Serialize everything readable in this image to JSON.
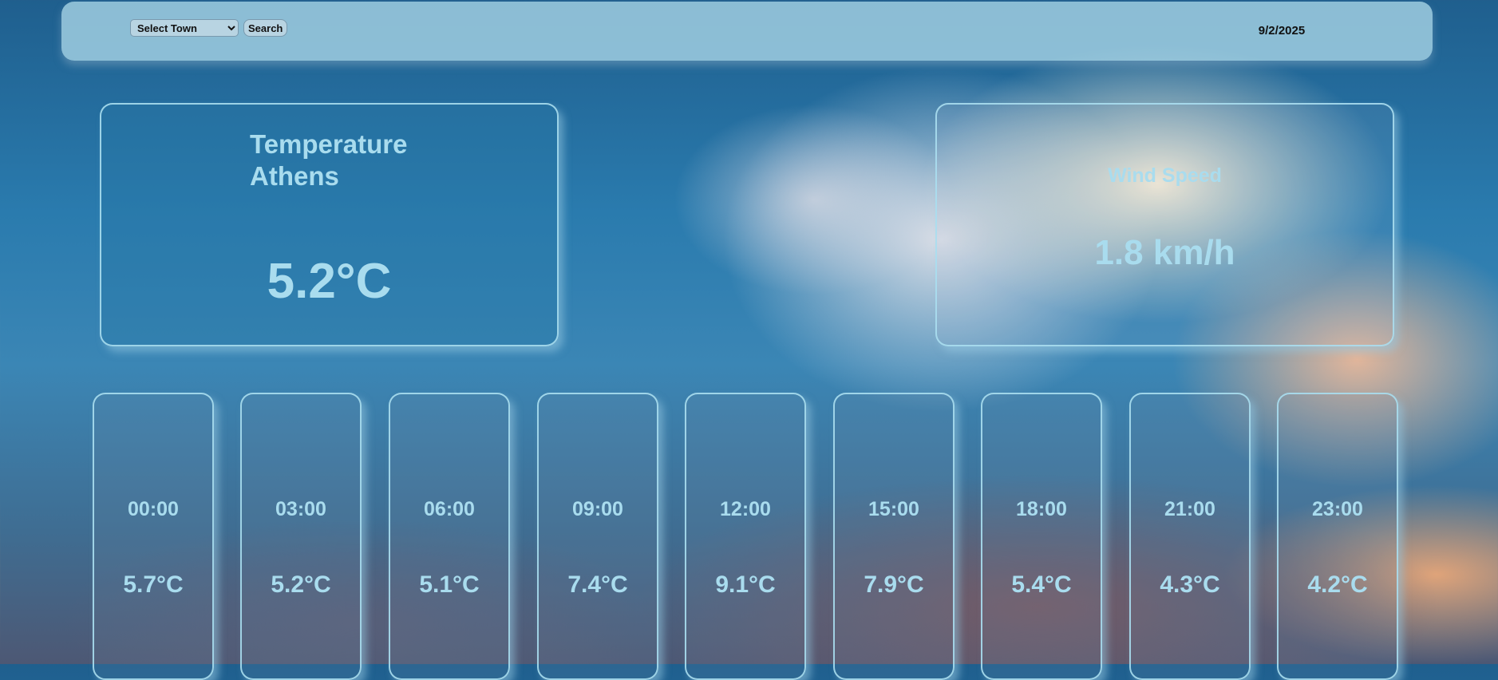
{
  "header": {
    "town_select": {
      "selected": "Select Town",
      "options": [
        "Select Town"
      ]
    },
    "search_label": "Search",
    "date": "9/2/2025"
  },
  "current": {
    "title_line1": "Temperature",
    "title_line2": "Athens",
    "temperature": "5.2°C"
  },
  "wind": {
    "title": "Wind Speed",
    "value": "1.8 km/h"
  },
  "hourly": [
    {
      "time": "00:00",
      "temp": "5.7°C"
    },
    {
      "time": "03:00",
      "temp": "5.2°C"
    },
    {
      "time": "06:00",
      "temp": "5.1°C"
    },
    {
      "time": "09:00",
      "temp": "7.4°C"
    },
    {
      "time": "12:00",
      "temp": "9.1°C"
    },
    {
      "time": "15:00",
      "temp": "7.9°C"
    },
    {
      "time": "18:00",
      "temp": "5.4°C"
    },
    {
      "time": "21:00",
      "temp": "4.3°C"
    },
    {
      "time": "23:00",
      "temp": "4.2°C"
    }
  ]
}
